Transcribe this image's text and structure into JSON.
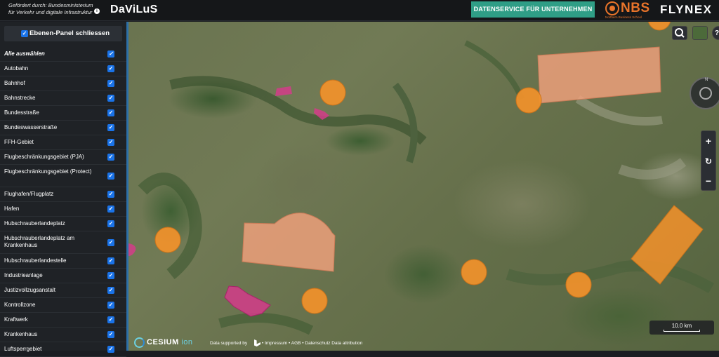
{
  "header": {
    "funded_line1": "Gefördert durch: Bundesministerium",
    "funded_line2": "für Verkehr und digitale Infrastruktur",
    "info_icon": "i",
    "app_title": "DaViLuS",
    "datenservice_label": "DATENSERVICE FÜR UNTERNEHMEN",
    "nbs_logo_text": "NBS",
    "nbs_logo_sub": "Northern Business School",
    "flynex_logo_text": "FLYNEX"
  },
  "sidebar": {
    "panel_toggle_label": "Ebenen-Panel schliessen",
    "check_glyph": "✓",
    "layers": [
      {
        "label": "Alle auswählen",
        "checked": true
      },
      {
        "label": "Autobahn",
        "checked": true
      },
      {
        "label": "Bahnhof",
        "checked": true
      },
      {
        "label": "Bahnstrecke",
        "checked": true
      },
      {
        "label": "Bundesstraße",
        "checked": true
      },
      {
        "label": "Bundeswasserstraße",
        "checked": true
      },
      {
        "label": "FFH-Gebiet",
        "checked": true
      },
      {
        "label": "Flugbeschränkungsgebiet (PJA)",
        "checked": true
      },
      {
        "label": "Flugbeschränkungsgebiet (Protect)",
        "checked": true
      },
      {
        "label": "Flughafen/Flugplatz",
        "checked": true
      },
      {
        "label": "Hafen",
        "checked": true
      },
      {
        "label": "Hubschrauberlandeplatz",
        "checked": true
      },
      {
        "label": "Hubschrauberlandeplatz am Krankenhaus",
        "checked": true
      },
      {
        "label": "Hubschrauberlandestelle",
        "checked": true
      },
      {
        "label": "Industrieanlage",
        "checked": true
      },
      {
        "label": "Justizvollzugsanstalt",
        "checked": true
      },
      {
        "label": "Kontrollzone",
        "checked": true
      },
      {
        "label": "Kraftwerk",
        "checked": true
      },
      {
        "label": "Krankenhaus",
        "checked": true
      },
      {
        "label": "Luftsperrgebiet",
        "checked": true
      }
    ]
  },
  "map": {
    "controls": {
      "search_icon": "search-icon",
      "basemap_icon": "basemap-picker-icon",
      "help_label": "?",
      "compass_north": "N",
      "zoom_in": "+",
      "reset_view": "↻",
      "zoom_out": "−"
    },
    "scale_label": "10.0 km",
    "attribution": {
      "cesium": "CESIUM",
      "ion": "ion",
      "data_supported": "Data supported by",
      "links": "• Impressum • AGB • Datenschutz  Data attribution"
    },
    "colors": {
      "orange_zone": "#f5922a",
      "salmon_zone": "#f2a17c",
      "pink_zone": "#d43c8a",
      "accent_teal": "#2f9e86",
      "checkbox_blue": "#1a73e8"
    }
  }
}
